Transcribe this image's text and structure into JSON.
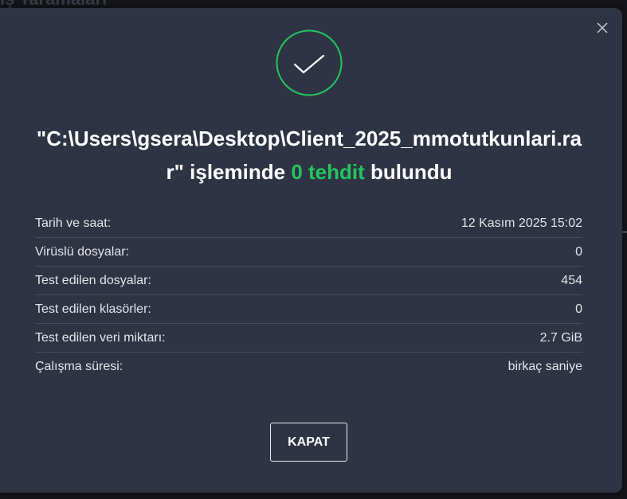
{
  "background": {
    "title": "ış Taramaları"
  },
  "colors": {
    "dialog_bg": "#2f3444",
    "accent_green": "#22c55e",
    "text": "#ffffff"
  },
  "icons": {
    "close": "close-icon",
    "status": "checkmark-circle-icon"
  },
  "headline": {
    "prefix": "\"C:\\Users\\gsera\\Desktop\\Client_2025_mmotutkunlari.rar\" işleminde ",
    "threat_count": "0 tehdit",
    "suffix": " bulundu"
  },
  "details": [
    {
      "label": "Tarih ve saat:",
      "value": "12 Kasım 2025 15:02"
    },
    {
      "label": "Virüslü dosyalar:",
      "value": "0"
    },
    {
      "label": "Test edilen dosyalar:",
      "value": "454"
    },
    {
      "label": "Test edilen klasörler:",
      "value": "0"
    },
    {
      "label": "Test edilen veri miktarı:",
      "value": "2.7 GiB"
    },
    {
      "label": "Çalışma süresi:",
      "value": "birkaç saniye"
    }
  ],
  "buttons": {
    "close_label": "KAPAT"
  }
}
